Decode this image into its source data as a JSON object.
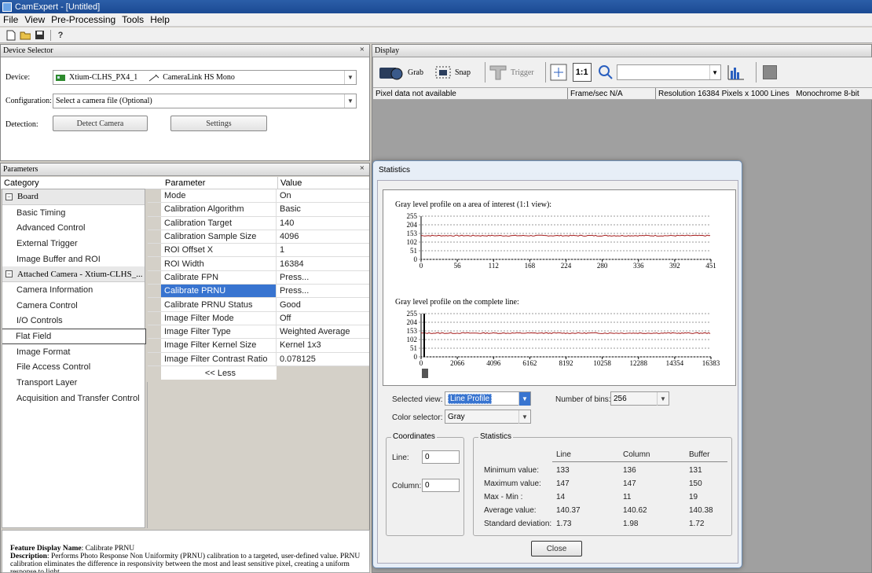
{
  "window": {
    "title": "CamExpert - [Untitled]"
  },
  "menu": [
    "File",
    "View",
    "Pre-Processing",
    "Tools",
    "Help"
  ],
  "device_selector": {
    "header": "Device Selector",
    "close": "×",
    "device_label": "Device:",
    "device_name": "Xtium-CLHS_PX4_1",
    "camera_link": "CameraLink HS Mono",
    "configuration_label": "Configuration:",
    "configuration_value": "Select a camera file (Optional)",
    "detection_label": "Detection:",
    "detect_button": "Detect Camera",
    "settings_button": "Settings"
  },
  "parameters": {
    "header": "Parameters",
    "close": "×",
    "category_header": "Category",
    "parameter_header": "Parameter",
    "value_header": "Value",
    "categories": [
      {
        "label": "Board",
        "type": "group"
      },
      {
        "label": "Basic Timing",
        "type": "item"
      },
      {
        "label": "Advanced Control",
        "type": "item"
      },
      {
        "label": "External Trigger",
        "type": "item"
      },
      {
        "label": "Image Buffer and ROI",
        "type": "item"
      },
      {
        "label": "Attached Camera - Xtium-CLHS_...",
        "type": "group"
      },
      {
        "label": "Camera Information",
        "type": "item"
      },
      {
        "label": "Camera Control",
        "type": "item"
      },
      {
        "label": "I/O Controls",
        "type": "item"
      },
      {
        "label": "Flat Field",
        "type": "selected"
      },
      {
        "label": "Image Format",
        "type": "item"
      },
      {
        "label": "File Access Control",
        "type": "item"
      },
      {
        "label": "Transport Layer",
        "type": "item"
      },
      {
        "label": "Acquisition and Transfer Control",
        "type": "item"
      }
    ],
    "rows": [
      {
        "name": "Mode",
        "value": "On"
      },
      {
        "name": "Calibration Algorithm",
        "value": "Basic"
      },
      {
        "name": "Calibration Target",
        "value": "140"
      },
      {
        "name": "Calibration Sample Size",
        "value": "4096"
      },
      {
        "name": "ROI Offset X",
        "value": "1"
      },
      {
        "name": "ROI Width",
        "value": "16384"
      },
      {
        "name": "Calibrate FPN",
        "value": "Press..."
      },
      {
        "name": "Calibrate PRNU",
        "value": "Press...",
        "selected": true
      },
      {
        "name": "Calibrate PRNU Status",
        "value": "Good"
      },
      {
        "name": "Image Filter Mode",
        "value": "Off"
      },
      {
        "name": "Image Filter Type",
        "value": "Weighted Average"
      },
      {
        "name": "Image Filter Kernel Size",
        "value": "Kernel 1x3"
      },
      {
        "name": "Image Filter Contrast Ratio",
        "value": "0.078125"
      }
    ],
    "less_button": "<< Less"
  },
  "feature": {
    "name_label": "Feature Display Name",
    "name_value": ": Calibrate PRNU",
    "desc_label": "Description",
    "desc_value": ": Performs Photo Response Non Uniformity (PRNU) calibration to a targeted, user-defined value. PRNU calibration eliminates the difference in responsivity between the most and least sensitive pixel, creating a uniform response to light."
  },
  "display": {
    "header": "Display",
    "grab": "Grab",
    "snap": "Snap",
    "trigger": "Trigger",
    "one_to_one": "1:1",
    "status_pixel": "Pixel data not available",
    "status_fps": "Frame/sec N/A",
    "status_resolution": "Resolution 16384 Pixels x 1000 Lines   Monochrome 8-bit"
  },
  "statistics": {
    "title": "Statistics",
    "graph1_title": "Gray level profile on a area of interest (1:1 view):",
    "graph1_yticks": [
      "255",
      "204",
      "153",
      "102",
      "51",
      "0"
    ],
    "graph1_xticks": [
      "0",
      "56",
      "112",
      "168",
      "224",
      "280",
      "336",
      "392",
      "451"
    ],
    "graph2_title": "Gray level profile on the complete line:",
    "graph2_yticks": [
      "255",
      "204",
      "153",
      "102",
      "51",
      "0"
    ],
    "graph2_xticks": [
      "0",
      "2066",
      "4096",
      "6162",
      "8192",
      "10258",
      "12288",
      "14354",
      "16383"
    ],
    "selected_view_label": "Selected view:",
    "selected_view_value": "Line Profile",
    "bins_label": "Number of bins:",
    "bins_value": "256",
    "color_selector_label": "Color selector:",
    "color_selector_value": "Gray",
    "coordinates_label": "Coordinates",
    "line_label": "Line:",
    "line_value": "0",
    "column_label": "Column:",
    "column_value": "0",
    "stats_label": "Statistics",
    "stats_cols": [
      "Line",
      "Column",
      "Buffer"
    ],
    "stats_rows": [
      {
        "label": "Minimum value:",
        "values": [
          "133",
          "136",
          "131"
        ]
      },
      {
        "label": "Maximum value:",
        "values": [
          "147",
          "147",
          "150"
        ]
      },
      {
        "label": "Max - Min :",
        "values": [
          "14",
          "11",
          "19"
        ]
      },
      {
        "label": "Average value:",
        "values": [
          "140.37",
          "140.62",
          "140.38"
        ]
      },
      {
        "label": "Standard deviation:",
        "values": [
          "1.73",
          "1.98",
          "1.72"
        ]
      }
    ],
    "close_button": "Close"
  },
  "colors": {
    "profile_line": "#a31a1a",
    "selection": "#3874d0",
    "title_bar": "#1b4a93"
  }
}
